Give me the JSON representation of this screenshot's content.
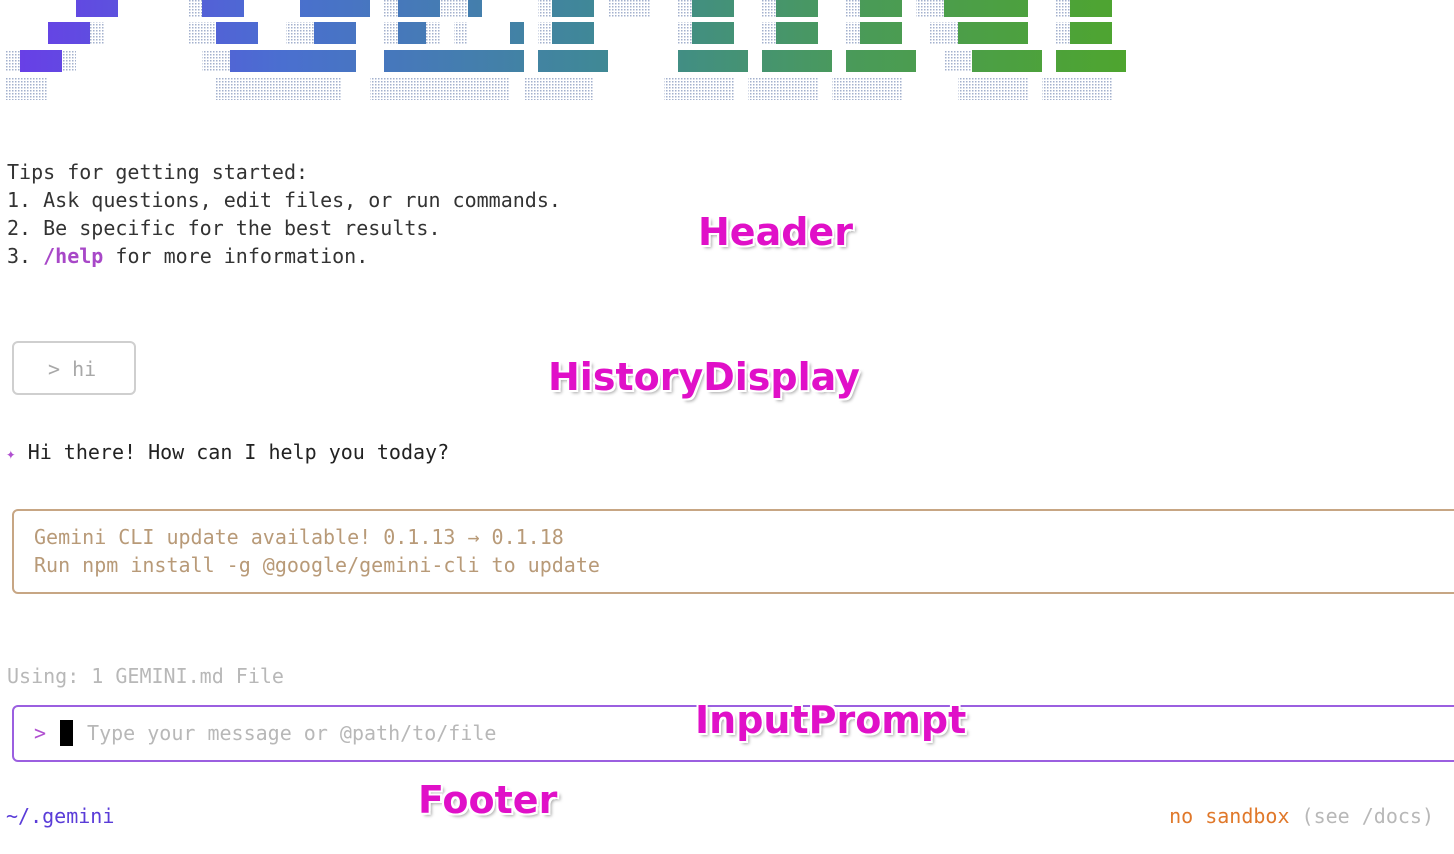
{
  "tips": {
    "heading": "Tips for getting started:",
    "items": [
      {
        "num": "1.",
        "text": " Ask questions, edit files, or run commands."
      },
      {
        "num": "2.",
        "text": " Be specific for the best results."
      },
      {
        "num": "3.",
        "command": "/help",
        "text": " for more information."
      }
    ]
  },
  "annotations": {
    "header": "Header",
    "history": "HistoryDisplay",
    "input": "InputPrompt",
    "footer": "Footer"
  },
  "history": {
    "user_message": "> hi",
    "assistant_icon": "✦",
    "assistant_message": "Hi there! How can I help you today?"
  },
  "update_notice": {
    "line1": "Gemini CLI update available! 0.1.13 → 0.1.18",
    "line2": "Run npm install -g @google/gemini-cli to update"
  },
  "context_info": "Using: 1 GEMINI.md File",
  "input": {
    "prompt": ">",
    "placeholder": "Type your message or @path/to/file"
  },
  "footer": {
    "path": "~/.gemini",
    "sandbox": "no sandbox",
    "docs_hint": "(see /docs)"
  },
  "colors": {
    "logo_gradient": [
      "#6a3ce8",
      "#4a6fd0",
      "#3f8a92",
      "#4a9a5a",
      "#4ea52e"
    ],
    "accent_purple": "#b050d0",
    "input_border": "#9b5fe0",
    "update_border": "#c7a684",
    "sandbox_orange": "#e0782a",
    "path_blue": "#5a3cd8"
  }
}
